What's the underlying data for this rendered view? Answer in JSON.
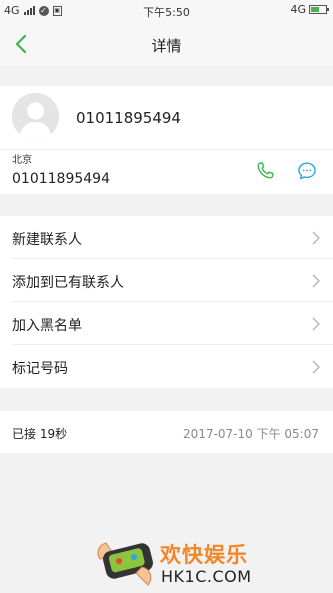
{
  "status_bar": {
    "network": "4G",
    "time": "下午5:50",
    "network_right": "4G",
    "battery_level": 0.6,
    "icons": [
      "signal-icon",
      "check-circle-icon",
      "sim-icon",
      "battery-icon"
    ]
  },
  "header": {
    "title": "详情",
    "back_icon": "chevron-left-icon"
  },
  "contact": {
    "number": "01011895494",
    "location": "北京",
    "sub_number": "01011895494",
    "actions": [
      "phone-icon",
      "message-icon"
    ]
  },
  "menu": {
    "items": [
      {
        "label": "新建联系人"
      },
      {
        "label": "添加到已有联系人"
      },
      {
        "label": "加入黑名单"
      },
      {
        "label": "标记号码"
      }
    ]
  },
  "call_log": {
    "status": "已接  19秒",
    "datetime": "2017-07-10  下午 05:07"
  },
  "watermark": {
    "title": "欢快娱乐",
    "domain": "HK1C.COM"
  },
  "colors": {
    "accent_green": "#3bb54a",
    "message_blue": "#2aa6e0",
    "watermark_orange": "#f2862a"
  }
}
